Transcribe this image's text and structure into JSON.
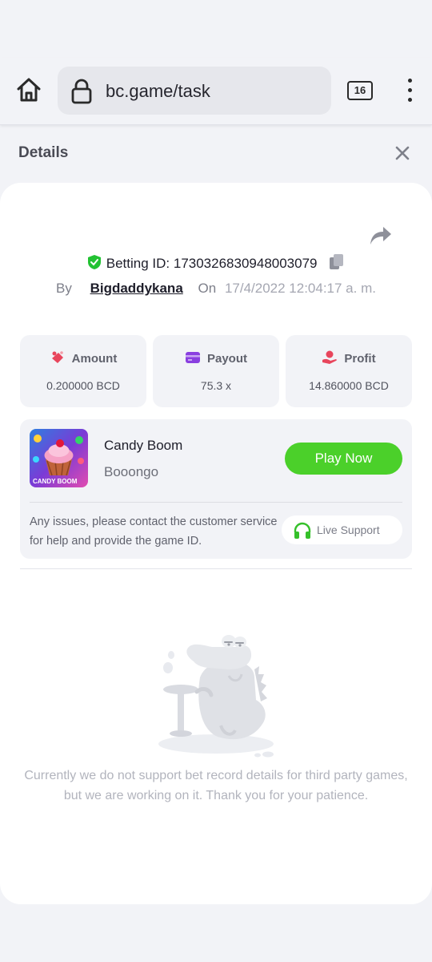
{
  "browser": {
    "url": "bc.game/task",
    "tab_count": "16",
    "icons": [
      "home-icon",
      "lock-icon",
      "tabs-icon",
      "more-vertical-icon"
    ]
  },
  "details": {
    "title": "Details",
    "betting_id_label": "Betting ID:",
    "betting_id": "1730326830948003079",
    "by_label": "By",
    "username": "Bigdaddykana",
    "on_label": "On",
    "datetime": "17/4/2022 12:04:17 a. m."
  },
  "stats": [
    {
      "label": "Amount",
      "value": "0.200000 BCD",
      "icon": "coins-icon",
      "color": "#e8455c"
    },
    {
      "label": "Payout",
      "value": "75.3 x",
      "icon": "card-icon",
      "color": "#8a3fe0"
    },
    {
      "label": "Profit",
      "value": "14.860000 BCD",
      "icon": "hand-coin-icon",
      "color": "#e8455c"
    }
  ],
  "game": {
    "name": "Candy Boom",
    "provider": "Booongo",
    "thumb_caption": "CANDY BOOM",
    "play_label": "Play Now",
    "issue_text": "Any issues, please contact the customer service for help and provide the game ID.",
    "support_label": "Live Support"
  },
  "empty_state": {
    "message": "Currently we do not support bet record details for third party games, but we are working on it. Thank you for your patience."
  },
  "colors": {
    "accent_green": "#4bd02a",
    "background": "#f2f3f7",
    "panel": "#ffffff"
  }
}
